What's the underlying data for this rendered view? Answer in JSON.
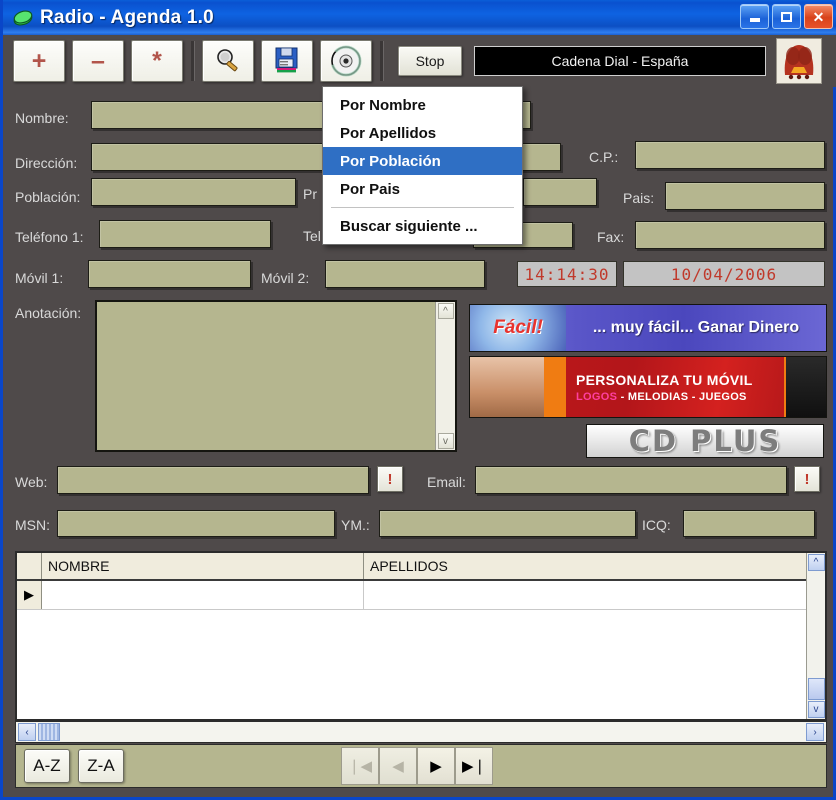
{
  "window": {
    "title": "Radio - Agenda 1.0",
    "app_icon": "green-disc-icon",
    "controls": {
      "minimize": "Minimize",
      "maximize": "Maximize",
      "close": "Close"
    }
  },
  "toolbar": {
    "buttons": [
      {
        "name": "add-record-button",
        "glyph": "+"
      },
      {
        "name": "delete-record-button",
        "glyph": "–"
      },
      {
        "name": "clear-record-button",
        "glyph": "*"
      }
    ],
    "search_icon": "magnifier-icon",
    "save_icon": "floppy-disk-icon",
    "cd_icon": "cd-disc-icon",
    "stop_label": "Stop",
    "station_display": "Cadena Dial - España",
    "radio_logo": "radio-set-icon"
  },
  "menu": {
    "items": [
      {
        "label": "Por Nombre",
        "selected": false
      },
      {
        "label": "Por Apellidos",
        "selected": false
      },
      {
        "label": "Por Población",
        "selected": true
      },
      {
        "label": "Por Pais",
        "selected": false
      }
    ],
    "footer_item": "Buscar siguiente ..."
  },
  "form": {
    "labels": {
      "nombre": "Nombre:",
      "direccion": "Dirección:",
      "poblacion": "Población:",
      "provincia": "Pr",
      "telefono1": "Teléfono 1:",
      "telefono2": "Tel",
      "movil1": "Móvil 1:",
      "movil2": "Móvil 2:",
      "cp": "C.P.:",
      "pais": "Pais:",
      "fax": "Fax:",
      "anotacion": "Anotación:",
      "web": "Web:",
      "email": "Email:",
      "msn": "MSN:",
      "ym": "YM.:",
      "icq": "ICQ:"
    },
    "values": {
      "nombre": "",
      "direccion": "",
      "poblacion": "",
      "provincia": "",
      "telefono1": "",
      "telefono2": "",
      "movil1": "",
      "movil2": "",
      "cp": "",
      "pais": "",
      "fax": "",
      "anotacion": "",
      "web": "",
      "email": "",
      "msn": "",
      "ym": "",
      "icq": ""
    },
    "bang_button_label": "!"
  },
  "status": {
    "time": "14:14:30",
    "date": "10/04/2006"
  },
  "ads": {
    "banner1": {
      "brand": "Fácil!",
      "text": "... muy fácil... Ganar Dinero"
    },
    "banner2": {
      "headline": "PERSONALIZA TU MÓVIL",
      "sub_highlight": "LOGOS",
      "sub_rest": " - MELODIAS - JUEGOS"
    },
    "banner3": {
      "text": "CD PLUS"
    }
  },
  "grid": {
    "columns": [
      "NOMBRE",
      "APELLIDOS"
    ],
    "rows": [
      {
        "NOMBRE": "",
        "APELLIDOS": ""
      }
    ],
    "row_indicator": "▶"
  },
  "bottom": {
    "sort_asc": "A-Z",
    "sort_desc": "Z-A",
    "nav": [
      {
        "name": "nav-first-button",
        "glyph": "❘◀",
        "disabled": true
      },
      {
        "name": "nav-prev-button",
        "glyph": "◀",
        "disabled": true
      },
      {
        "name": "nav-next-button",
        "glyph": "▶",
        "disabled": false
      },
      {
        "name": "nav-last-button",
        "glyph": "▶❘",
        "disabled": false
      }
    ]
  },
  "colors": {
    "titlebar": "#0e63e2",
    "form_background": "#4f4a4a",
    "field": "#b5b68f",
    "menu_highlight": "#2f6fc4",
    "lcd_text": "#c0392b"
  }
}
